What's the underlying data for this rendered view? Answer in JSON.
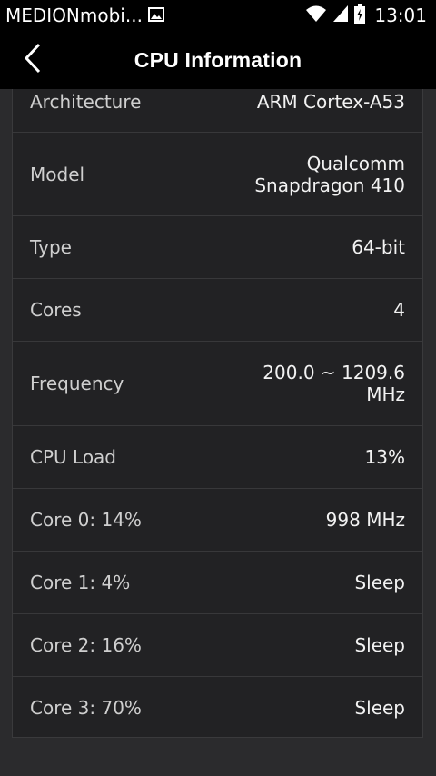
{
  "status_bar": {
    "carrier": "MEDIONmobi...",
    "time": "13:01",
    "icons": [
      "image-icon",
      "wifi-icon",
      "signal-icon",
      "battery-charging-icon"
    ]
  },
  "app_bar": {
    "title": "CPU Information",
    "back_icon": "chevron-left-icon"
  },
  "rows": [
    {
      "label": "Architecture",
      "value": "ARM Cortex-A53"
    },
    {
      "label": "Model",
      "value": "Qualcomm\nSnapdragon 410"
    },
    {
      "label": "Type",
      "value": "64-bit"
    },
    {
      "label": "Cores",
      "value": "4"
    },
    {
      "label": "Frequency",
      "value": "200.0 ~ 1209.6\nMHz"
    },
    {
      "label": "CPU Load",
      "value": "13%"
    },
    {
      "label": "Core 0: 14%",
      "value": "998 MHz"
    },
    {
      "label": "Core 1: 4%",
      "value": "Sleep"
    },
    {
      "label": "Core 2: 16%",
      "value": "Sleep"
    },
    {
      "label": "Core 3: 70%",
      "value": "Sleep"
    }
  ],
  "colors": {
    "background": "#2b2b2d",
    "list_background": "#222224",
    "bar_background": "#000000",
    "text_primary": "#f2f2f2"
  }
}
